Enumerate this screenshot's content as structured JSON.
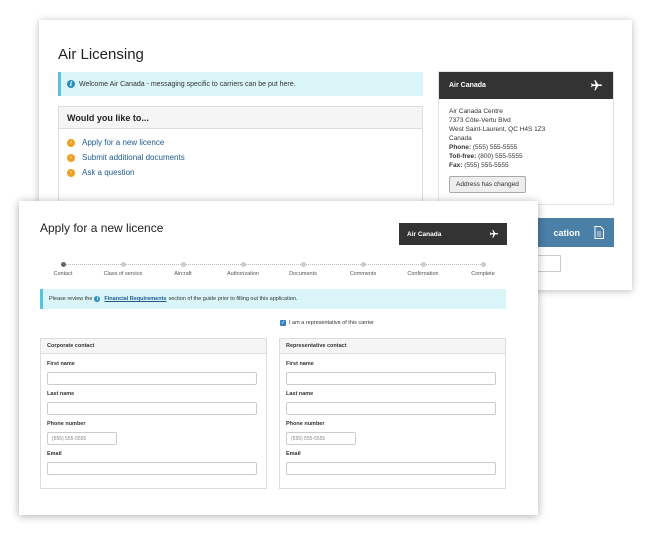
{
  "back": {
    "title": "Air Licensing",
    "banner": "Welcome Air Canada - messaging specific to carriers can be put here.",
    "wyl_heading": "Would you like to...",
    "wyl_items": [
      "Apply for a new licence",
      "Submit additional documents",
      "Ask a question"
    ],
    "carrier_name": "Air Canada",
    "address_lines": [
      "Air Canada Centre",
      "7373 Côte-Vertu Blvd",
      "West Saint-Laurent, QC H4S 1Z3",
      "Canada"
    ],
    "phone_label": "Phone:",
    "phone": "(555) 555-5555",
    "tollfree_label": "Toll-free:",
    "tollfree": "(800) 555-5555",
    "fax_label": "Fax:",
    "fax": "(555) 555-5555",
    "address_button": "Address has changed",
    "blue_bar_text": "cation"
  },
  "front": {
    "title": "Apply for a new licence",
    "carrier_name": "Air Canada",
    "steps": [
      "Contact",
      "Class of service",
      "Aircraft",
      "Authorization",
      "Documents",
      "Comments",
      "Confirmation",
      "Complete"
    ],
    "active_step": 0,
    "banner_prefix": "Please review the",
    "banner_link": "Financial Requirements",
    "banner_suffix": "section of the guide prior to filling out this application.",
    "rep_checkbox_label": "I am a representative of this carrier",
    "corporate": {
      "heading": "Corporate contact",
      "first_name": "First name",
      "last_name": "Last name",
      "phone_label": "Phone number",
      "phone_placeholder": "(555) 555-5555",
      "email": "Email"
    },
    "representative": {
      "heading": "Representative contact",
      "first_name": "First name",
      "last_name": "Last name",
      "phone_label": "Phone number",
      "phone_placeholder": "(555) 555-5555",
      "email": "Email"
    }
  },
  "colors": {
    "info_bg": "#d9f5f7",
    "info_border": "#5bc0de",
    "link": "#1f5b8e",
    "dark_header": "#333333",
    "blue_bar": "#4a7fa8",
    "arrow": "#f0a020"
  },
  "icons": {
    "plane": "airplane-icon",
    "info": "info-icon",
    "arrow": "arrow-circle-icon",
    "document": "document-icon"
  }
}
